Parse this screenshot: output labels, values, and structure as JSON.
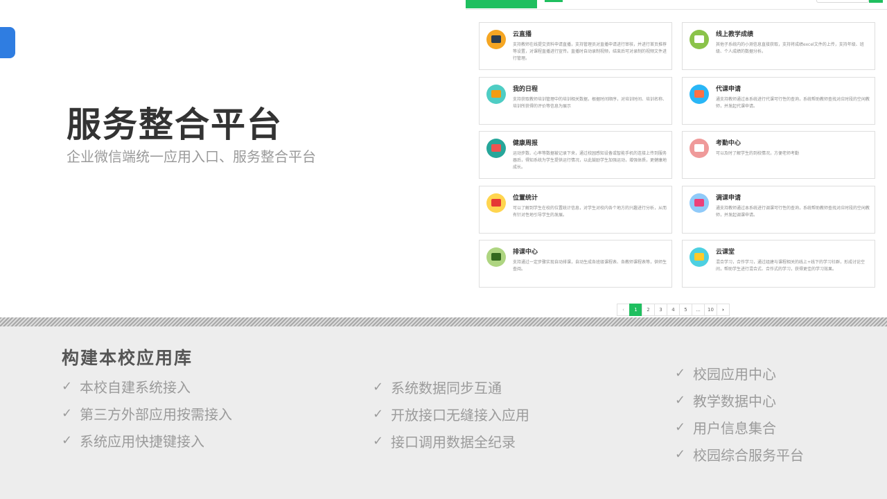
{
  "hero": {
    "title": "服务整合平台",
    "subtitle": "企业微信端统一应用入口、服务整合平台"
  },
  "apps": [
    {
      "title": "云直播",
      "desc": "支持教师在线提交资料申请直播，支持管理员对直播申请进行审核，并进行首页推荐等设置，对课程直播进行宣传。直播时自动录制视频，结束后可对录制的视频文件进行管理。",
      "icon": "video-camera-icon",
      "color": "#f5a623",
      "inner": "#2c3e50"
    },
    {
      "title": "线上教学成绩",
      "desc": "其他子系统内的小测信息直接获取，支持将成绩excel文件的上传，支持年级、班级、个人成绩的数据分析。",
      "icon": "grade-report-icon",
      "color": "#8bc34a",
      "inner": "#ffffff"
    },
    {
      "title": "我的日程",
      "desc": "支持获取教师培训管理中的培训相关数据，根据时间顺序，对培训时间、培训名称、培训所获得的评价等信息为展示",
      "icon": "schedule-icon",
      "color": "#4ecdc4",
      "inner": "#f39c12"
    },
    {
      "title": "代课申请",
      "desc": "通支持教师通过本系统进行代课可行性的查询，系统帮助教师查找对应时段的空闲教师，并发起代课申请。",
      "icon": "substitute-request-icon",
      "color": "#29b6f6",
      "inner": "#ff7043"
    },
    {
      "title": "健康周报",
      "desc": "运动步数、心率等数据被记录下来，通过校园感知设备或智能手机的连接上传到服务器后，得知系统为学生提供运行情况，以此鼓励学生加强运动，增强体质，更健康地成长。",
      "icon": "health-report-icon",
      "color": "#26a69a",
      "inner": "#ef5350"
    },
    {
      "title": "考勤中心",
      "desc": "可以及时了解学生的到校情况，方便老师考勤",
      "icon": "attendance-icon",
      "color": "#ef9a9a",
      "inner": "#ffffff"
    },
    {
      "title": "位置统计",
      "desc": "可以了解到学生在校的位置统计信息，对学生对校内各个地方的兴趣进行分析，从而有针对性地引导学生的发展。",
      "icon": "location-pin-icon",
      "color": "#ffd54f",
      "inner": "#e53935"
    },
    {
      "title": "调课申请",
      "desc": "通支持教师通过本系统进行调课可行性的查询，系统帮助教师查找对应时段的空闲教师，并发起调课申请。",
      "icon": "swap-class-icon",
      "color": "#90caf9",
      "inner": "#ec407a"
    },
    {
      "title": "排课中心",
      "desc": "支持通过一定步骤实现自动排课，自动生成各班级课程表、各教师课程表等，供师生查阅。",
      "icon": "timetable-board-icon",
      "color": "#aed581",
      "inner": "#33691e"
    },
    {
      "title": "云课堂",
      "desc": "混合学习，合作学习，通过组建与课程相关的线上+线下的学习社群，形成讨论空间，帮助学生进行混合式、合作式的学习，获得更佳的学习效果。",
      "icon": "cloud-classroom-icon",
      "color": "#4dd0e1",
      "inner": "#ffca28"
    }
  ],
  "pagination": {
    "prev": "‹",
    "pages": [
      "1",
      "2",
      "3",
      "4",
      "5",
      "...",
      "10"
    ],
    "next": "›",
    "current": "1"
  },
  "library": {
    "title": "构建本校应用库",
    "check": "✓",
    "col1": [
      "本校自建系统接入",
      "第三方外部应用按需接入",
      "系统应用快捷键接入"
    ],
    "col2": [
      "系统数据同步互通",
      "开放接口无缝接入应用",
      "接口调用数据全纪录"
    ],
    "col3": [
      "校园应用中心",
      "教学数据中心",
      "用户信息集合",
      "校园综合服务平台"
    ]
  }
}
